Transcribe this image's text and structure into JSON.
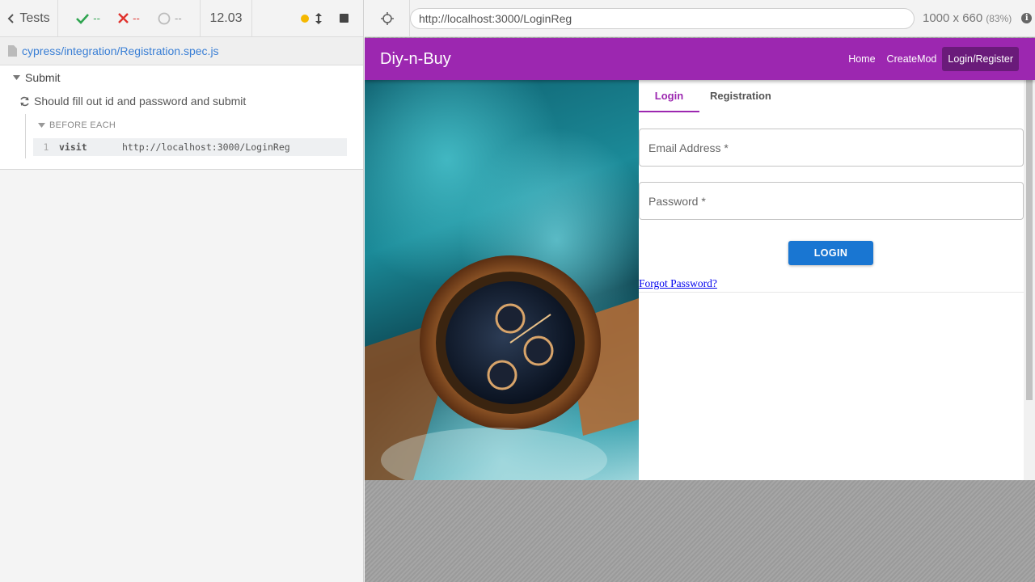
{
  "reporter": {
    "tests_label": "Tests",
    "passed": "--",
    "failed": "--",
    "pending": "--",
    "duration": "12.03",
    "spec_path": "cypress/integration/Registration.spec.js",
    "suite_title": "Submit",
    "test_title": "Should fill out id and password and submit",
    "hook_label": "BEFORE EACH",
    "command": {
      "number": "1",
      "name": "visit",
      "message": "http://localhost:3000/LoginReg"
    }
  },
  "aut": {
    "url": "http://localhost:3000/LoginReg",
    "viewport_size": "1000 x 660",
    "viewport_scale": "(83%)"
  },
  "app": {
    "brand": "Diy-n-Buy",
    "nav": [
      "Home",
      "CreateMod",
      "Login/Register"
    ],
    "tabs": [
      "Login",
      "Registration"
    ],
    "email_label": "Email Address *",
    "password_label": "Password *",
    "login_button": "LOGIN",
    "forgot_link": "Forgot Password?"
  },
  "colors": {
    "appbar": "#9c27b0",
    "primary_button": "#1976d2",
    "spec_link": "#3a7fd5",
    "pass": "#2ea44f",
    "fail": "#e0322d"
  }
}
